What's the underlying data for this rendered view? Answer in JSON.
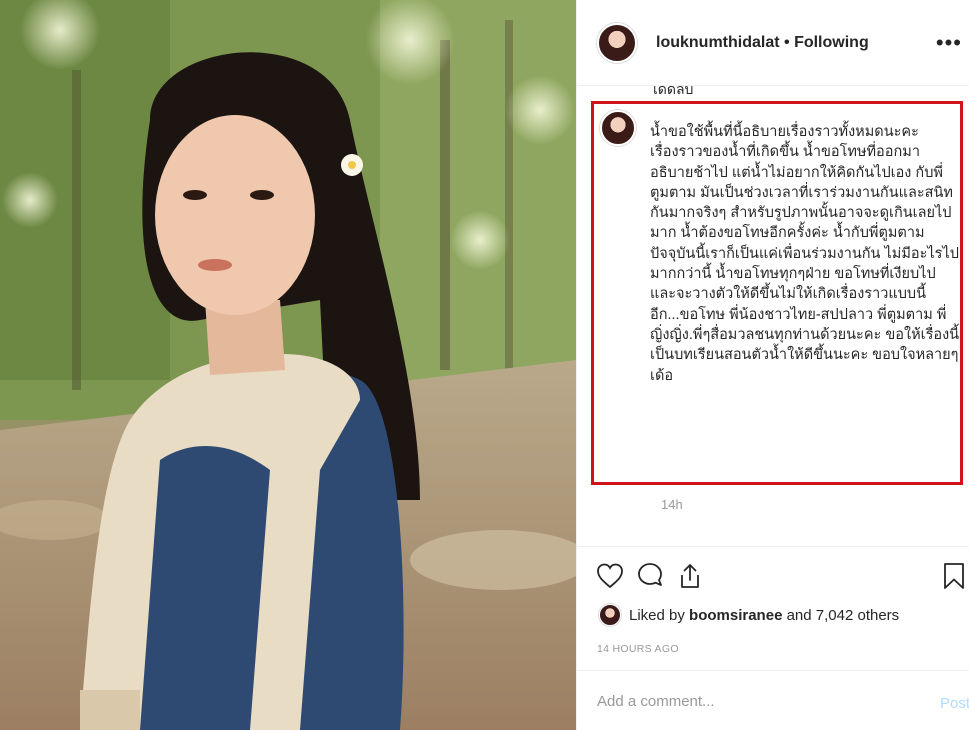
{
  "post": {
    "username": "louknumthidalat",
    "follow_status": "Following",
    "separator": " • ",
    "more_icon": "more-dots-icon"
  },
  "previous_comment_tail": "เดดลบ",
  "comment": {
    "text": "น้ำขอใช้พื้นที่นี้อธิบายเรื่องราวทั้งหมดนะคะ\nเรื่องราวของน้ำที่เกิดขึ้น น้ำขอโทษที่ออกมาอธิบายช้าไป แต่น้ำไม่อยากให้คิดกันไปเอง กับพี่ตูมตาม มันเป็นช่วงเวลาที่เราร่วมงานกันและสนิทกันมากจริงๆ สำหรับรูปภาพนั้นอาจจะดูเกินเลยไปมาก น้ำต้องขอโทษอีกครั้งค่ะ น้ำกับพี่ตูมตามปัจจุบันนี้เราก็เป็นแค่เพื่อนร่วมงานกัน ไม่มีอะไรไปมากกว่านี้ น้ำขอโทษทุกๆฝ่าย ขอโทษที่เงียบไป และจะวางตัวให้ดีขึ้นไม่ให้เกิดเรื่องราวแบบนี้อีก...ขอโทษ พี่น้องชาวไทย-สปปลาว พี่ตูมตาม พี่ญิ่งญิ่ง.พี่ๆสื่อมวลชนทุกท่านด้วยนะคะ ขอให้เรื่องนี้เป็นบทเรียนสอนตัวน้ำให้ดีขึ้นนะคะ ขอบใจหลายๆเด้อ",
    "timestamp": "14h",
    "highlight_color": "#d0121b"
  },
  "actions": {
    "icons": [
      "heart-icon",
      "comment-icon",
      "share-icon",
      "bookmark-icon"
    ]
  },
  "likes": {
    "prefix": "Liked by ",
    "user": "boomsiranee",
    "suffix": " and 7,042 others"
  },
  "time_ago": "14 HOURS AGO",
  "add_comment": {
    "placeholder": "Add a comment...",
    "post_label": "Post"
  },
  "colors": {
    "accent_disabled": "#b3dbff",
    "secondary_text": "#999999",
    "primary_text": "#262626"
  }
}
